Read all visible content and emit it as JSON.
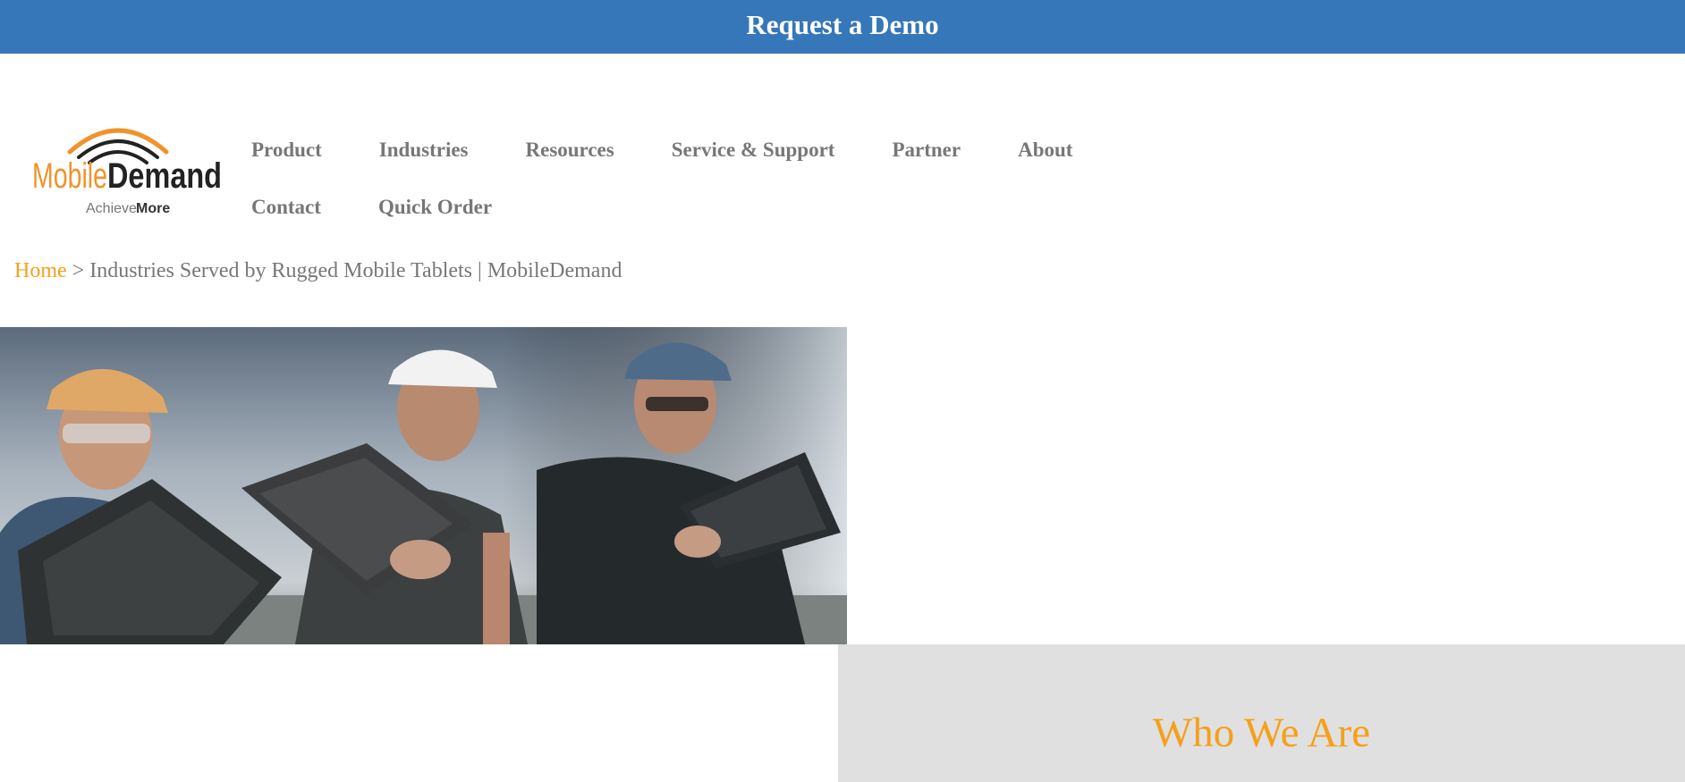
{
  "topbar": {
    "cta_label": "Request a Demo"
  },
  "logo": {
    "name": "MobileDemand",
    "name_part1": "Mobile",
    "name_part2": "Demand",
    "tagline_part1": "Achieve ",
    "tagline_part2": "More"
  },
  "nav": {
    "items": [
      "Product",
      "Industries",
      "Resources",
      "Service & Support",
      "Partner",
      "About",
      "Contact",
      "Quick Order"
    ]
  },
  "breadcrumb": {
    "home": "Home",
    "separator": " > ",
    "current": "Industries Served by Rugged Mobile Tablets | MobileDemand"
  },
  "hero": {
    "image": "workers-with-rugged-tablets-photo"
  },
  "section": {
    "heading": "Who We Are"
  },
  "colors": {
    "brand_blue": "#3577b8",
    "accent_orange": "#f5a01a",
    "nav_grey": "#777777",
    "panel_grey": "#e0e0e0"
  }
}
